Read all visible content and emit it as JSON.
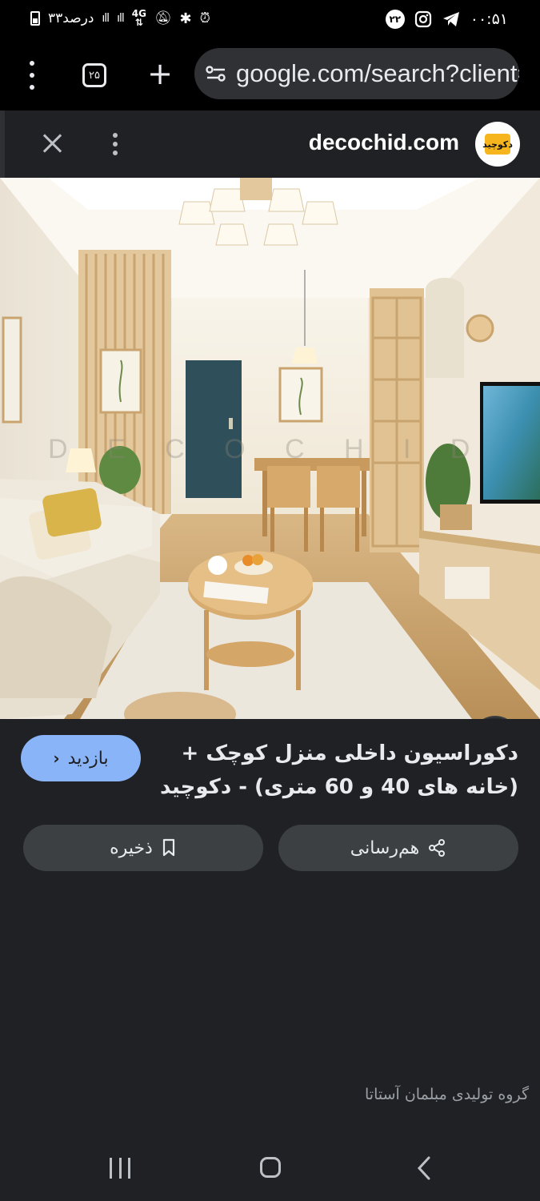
{
  "status_bar": {
    "battery_text": "۳۳درصد",
    "network": "4G",
    "notification_count": "۲۲",
    "time": "۰۰:۵۱"
  },
  "browser": {
    "tab_count": "۲۵",
    "url": "google.com/search?client=ms-android-samsung"
  },
  "result": {
    "site": "decochid.com",
    "logo_text": "دکوچید",
    "title": "دکوراسیون داخلی منزل کوچک + (خانه های 40 و 60 متری) - دکوچید",
    "visit_label": "بازدید",
    "share_label": "هم‌رسانی",
    "save_label": "ذخیره",
    "watermark": "D E C O C H I D",
    "caption": "گروه تولیدی مبلمان آستاتا"
  },
  "colors": {
    "sheet_bg": "#202124",
    "accent": "#8ab4f8",
    "chip_bg": "#3c4043"
  }
}
